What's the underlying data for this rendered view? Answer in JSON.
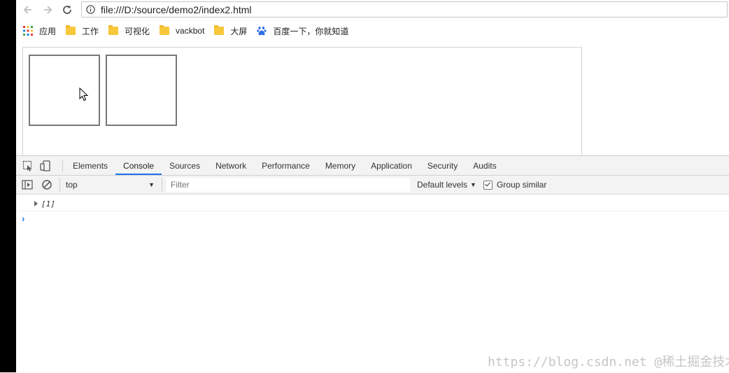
{
  "browser": {
    "url": "file:///D:/source/demo2/index2.html",
    "bookmarks": [
      {
        "label": "应用",
        "icon": "apps-grid-icon"
      },
      {
        "label": "工作",
        "icon": "folder-icon"
      },
      {
        "label": "可视化",
        "icon": "folder-icon"
      },
      {
        "label": "vackbot",
        "icon": "folder-icon"
      },
      {
        "label": "大屏",
        "icon": "folder-icon"
      },
      {
        "label": "百度一下，你就知道",
        "icon": "baidu-paw-icon"
      }
    ]
  },
  "devtools": {
    "tabs": [
      "Elements",
      "Console",
      "Sources",
      "Network",
      "Performance",
      "Memory",
      "Application",
      "Security",
      "Audits"
    ],
    "active_tab": "Console",
    "toolbar": {
      "context": "top",
      "filter_placeholder": "Filter",
      "levels": "Default levels",
      "group_similar": "Group similar"
    },
    "console": {
      "log_value": "[1]",
      "prompt": "›"
    }
  },
  "watermark": "https://blog.csdn.net  @稀土掘金技术社区",
  "colors": {
    "accent": "#1a73e8",
    "folder": "#f7c73c"
  }
}
